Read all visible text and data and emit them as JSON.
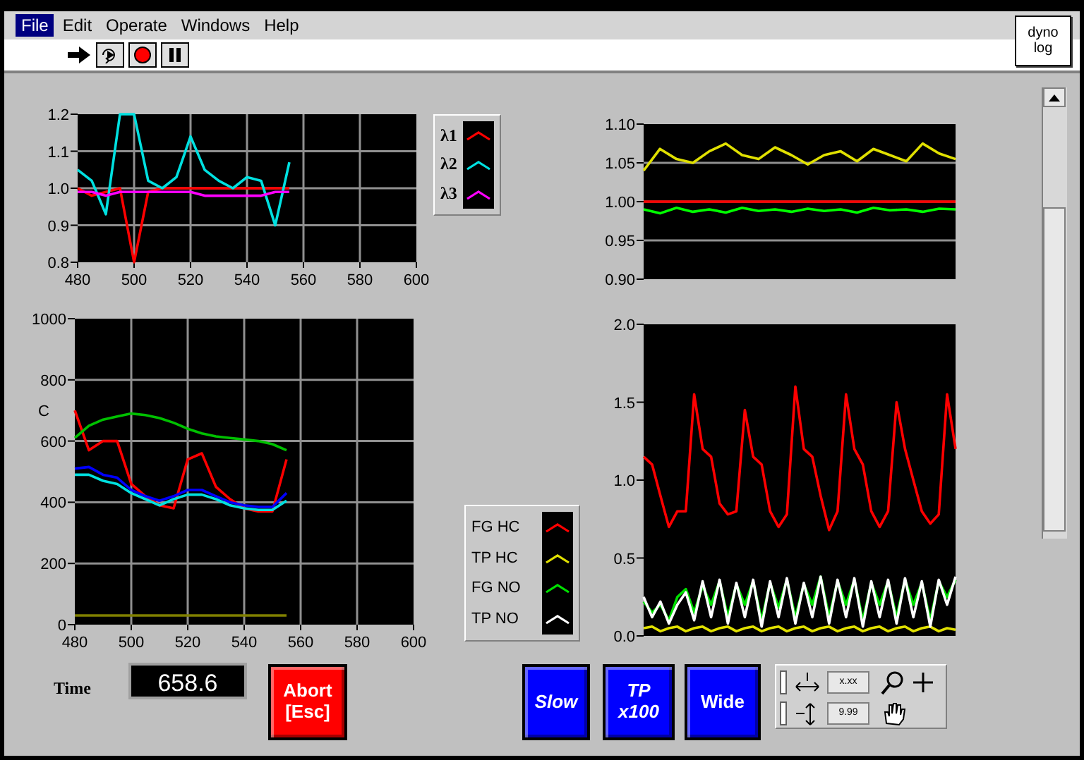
{
  "menu": [
    {
      "label": "File",
      "selected": true
    },
    {
      "label": "Edit",
      "selected": false
    },
    {
      "label": "Operate",
      "selected": false
    },
    {
      "label": "Windows",
      "selected": false
    },
    {
      "label": "Help",
      "selected": false
    }
  ],
  "log_button": {
    "label": "dyno log"
  },
  "charts": [
    {
      "chart_data": {
        "type": "line",
        "grid": true,
        "x": [
          480,
          485,
          490,
          495,
          500,
          505,
          510,
          515,
          520,
          525,
          530,
          535,
          540,
          545,
          550,
          555
        ],
        "xlim": [
          480,
          600
        ],
        "ylim": [
          0.8,
          1.2
        ],
        "xticks": [
          480,
          500,
          520,
          540,
          560,
          580,
          600
        ],
        "yticks": [
          {
            "value": 0.8,
            "label": "0.8"
          },
          {
            "value": 0.9,
            "label": "0.9"
          },
          {
            "value": 1.0,
            "label": "1.0"
          },
          {
            "value": 1.1,
            "label": "1.1"
          },
          {
            "value": 1.2,
            "label": "1.2"
          }
        ],
        "series": [
          {
            "name": "λ1",
            "color": "#ff0000",
            "values": [
              1.0,
              0.98,
              0.99,
              1.0,
              0.8,
              0.99,
              1.0,
              1.0,
              1.0,
              1.0,
              1.0,
              1.0,
              1.0,
              1.0,
              1.0,
              1.0
            ]
          },
          {
            "name": "λ2",
            "color": "#00e0e0",
            "values": [
              1.05,
              1.02,
              0.93,
              1.2,
              1.2,
              1.02,
              1.0,
              1.03,
              1.14,
              1.05,
              1.02,
              1.0,
              1.03,
              1.02,
              0.9,
              1.07
            ]
          },
          {
            "name": "λ3",
            "color": "#ff00ff",
            "values": [
              0.99,
              0.99,
              0.98,
              0.99,
              0.99,
              0.99,
              0.99,
              0.99,
              0.99,
              0.98,
              0.98,
              0.98,
              0.98,
              0.98,
              0.99,
              0.99
            ]
          }
        ]
      }
    },
    {
      "chart_data": {
        "type": "line",
        "grid": true,
        "ylabel": "C",
        "x": [
          480,
          485,
          490,
          495,
          500,
          505,
          510,
          515,
          520,
          525,
          530,
          535,
          540,
          545,
          550,
          555
        ],
        "xlim": [
          480,
          600
        ],
        "ylim": [
          0,
          1000
        ],
        "xticks": [
          480,
          500,
          520,
          540,
          560,
          580,
          600
        ],
        "yticks": [
          0,
          200,
          400,
          600,
          800,
          1000
        ],
        "series": [
          {
            "color": "#ff0000",
            "values": [
              700,
              570,
              600,
              600,
              460,
              420,
              390,
              380,
              540,
              560,
              450,
              410,
              380,
              370,
              370,
              540
            ]
          },
          {
            "color": "#00c000",
            "values": [
              610,
              650,
              670,
              680,
              690,
              685,
              675,
              660,
              640,
              625,
              615,
              610,
              605,
              600,
              590,
              570
            ]
          },
          {
            "color": "#0000ff",
            "values": [
              510,
              515,
              490,
              480,
              440,
              420,
              405,
              420,
              440,
              440,
              420,
              400,
              390,
              385,
              385,
              430
            ]
          },
          {
            "color": "#00e0e0",
            "values": [
              490,
              490,
              470,
              460,
              430,
              410,
              390,
              410,
              425,
              425,
              410,
              390,
              380,
              375,
              375,
              405
            ]
          },
          {
            "color": "#808000",
            "values": [
              30,
              30,
              30,
              30,
              30,
              30,
              30,
              30,
              30,
              30,
              30,
              30,
              30,
              30,
              30,
              30
            ]
          }
        ]
      }
    },
    {
      "chart_data": {
        "type": "line",
        "grid": true,
        "ylim": [
          0.9,
          1.1
        ],
        "yticks": [
          {
            "value": 0.9,
            "label": "0.90"
          },
          {
            "value": 0.95,
            "label": "0.95"
          },
          {
            "value": 1.0,
            "label": "1.00"
          },
          {
            "value": 1.05,
            "label": "1.05"
          },
          {
            "value": 1.1,
            "label": "1.10"
          }
        ],
        "series": [
          {
            "color": "#e0e000",
            "values": [
              1.04,
              1.068,
              1.055,
              1.05,
              1.065,
              1.075,
              1.06,
              1.055,
              1.07,
              1.06,
              1.048,
              1.06,
              1.065,
              1.052,
              1.068,
              1.06,
              1.052,
              1.075,
              1.062,
              1.055
            ]
          },
          {
            "color": "#ff0000",
            "values": [
              1.0,
              1.0,
              1.0,
              1.0,
              1.0,
              1.0,
              1.0,
              1.0,
              1.0,
              1.0,
              1.0,
              1.0,
              1.0,
              1.0,
              1.0,
              1.0,
              1.0,
              1.0,
              1.0,
              1.0
            ]
          },
          {
            "color": "#00ff00",
            "values": [
              0.99,
              0.985,
              0.992,
              0.987,
              0.99,
              0.986,
              0.992,
              0.988,
              0.99,
              0.987,
              0.991,
              0.988,
              0.99,
              0.986,
              0.992,
              0.989,
              0.99,
              0.987,
              0.991,
              0.99
            ]
          }
        ]
      }
    },
    {
      "chart_data": {
        "type": "line",
        "ylim": [
          0,
          2
        ],
        "yticks": [
          {
            "value": 0,
            "label": "0.0"
          },
          {
            "value": 0.5,
            "label": "0.5"
          },
          {
            "value": 1,
            "label": "1.0"
          },
          {
            "value": 1.5,
            "label": "1.5"
          },
          {
            "value": 2,
            "label": "2.0"
          }
        ],
        "series": [
          {
            "name": "FG HC",
            "color": "#ff0000",
            "values": [
              1.15,
              1.1,
              0.9,
              0.7,
              0.8,
              0.8,
              1.55,
              1.2,
              1.15,
              0.85,
              0.78,
              0.8,
              1.45,
              1.15,
              1.1,
              0.8,
              0.7,
              0.78,
              1.6,
              1.2,
              1.15,
              0.9,
              0.68,
              0.8,
              1.55,
              1.2,
              1.1,
              0.8,
              0.7,
              0.8,
              1.5,
              1.2,
              1.0,
              0.8,
              0.72,
              0.78,
              1.55,
              1.2
            ]
          },
          {
            "name": "TP HC",
            "color": "#e0e000",
            "values": [
              0.05,
              0.06,
              0.03,
              0.05,
              0.06,
              0.03,
              0.05,
              0.06,
              0.03,
              0.05,
              0.06,
              0.03,
              0.05,
              0.06,
              0.03,
              0.05,
              0.06,
              0.03,
              0.05,
              0.06,
              0.03,
              0.05,
              0.06,
              0.03,
              0.05,
              0.06,
              0.03,
              0.05,
              0.06,
              0.03,
              0.05,
              0.06,
              0.03,
              0.05,
              0.06,
              0.03,
              0.05,
              0.04
            ]
          },
          {
            "name": "FG NO",
            "color": "#00e000",
            "values": [
              0.22,
              0.15,
              0.2,
              0.1,
              0.25,
              0.3,
              0.15,
              0.32,
              0.2,
              0.35,
              0.12,
              0.33,
              0.2,
              0.35,
              0.1,
              0.34,
              0.18,
              0.36,
              0.12,
              0.33,
              0.2,
              0.38,
              0.12,
              0.35,
              0.2,
              0.36,
              0.1,
              0.34,
              0.2,
              0.35,
              0.12,
              0.36,
              0.2,
              0.34,
              0.1,
              0.35,
              0.25,
              0.36
            ]
          },
          {
            "name": "TP NO",
            "color": "#ffffff",
            "values": [
              0.25,
              0.12,
              0.22,
              0.08,
              0.2,
              0.28,
              0.1,
              0.35,
              0.12,
              0.36,
              0.08,
              0.34,
              0.12,
              0.36,
              0.06,
              0.35,
              0.12,
              0.37,
              0.08,
              0.34,
              0.12,
              0.38,
              0.08,
              0.36,
              0.12,
              0.37,
              0.06,
              0.35,
              0.12,
              0.36,
              0.08,
              0.37,
              0.12,
              0.35,
              0.06,
              0.36,
              0.2,
              0.38
            ]
          }
        ]
      }
    }
  ],
  "time": {
    "label": "Time",
    "value": "658.6"
  },
  "buttons": [
    {
      "label": "Abort [Esc]",
      "color": "#ff0000"
    },
    {
      "label": "Slow",
      "color": "#0000ff"
    },
    {
      "label": "TP x100",
      "color": "#0000ff"
    },
    {
      "label": "Wide",
      "color": "#0000ff"
    }
  ],
  "palette": {
    "x_format": "x.xx",
    "y_format": "9.99"
  }
}
